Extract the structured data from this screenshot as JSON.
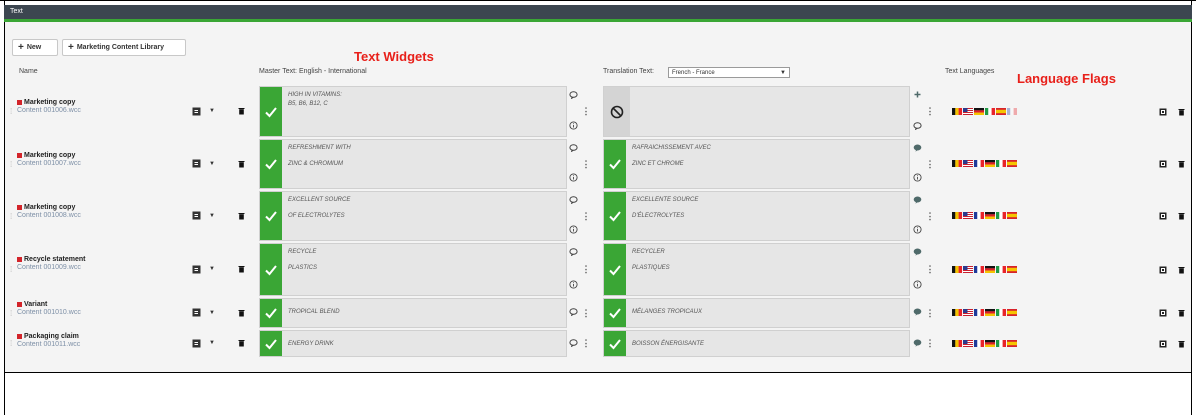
{
  "window": {
    "title": "Text"
  },
  "toolbar": {
    "new_label": "New",
    "library_label": "Marketing Content Library"
  },
  "columns": {
    "name": "Name",
    "master": "Master Text: English - International",
    "translation_label": "Translation Text:",
    "translation_value": "French - France",
    "languages": "Text Languages"
  },
  "annotations": {
    "widgets": "Text Widgets",
    "flags": "Language Flags"
  },
  "colors": {
    "check_green": "#3aa635",
    "status_red": "#d3242a",
    "title_bar": "#3c4650",
    "annotation_red": "#e8201a"
  },
  "icons": [
    "plus-icon",
    "sync-icon",
    "chevron-down-icon",
    "trash-icon",
    "checkmark-icon",
    "comment-icon",
    "info-icon",
    "kebab-icon",
    "blocked-icon",
    "edit-icon",
    "flag-icon"
  ],
  "rows": [
    {
      "name": "Marketing copy",
      "file": "Content 001006.wcc",
      "master_lines": [
        "HIGH IN VITAMINS:",
        "B5, B6, B12, C"
      ],
      "translation_lines": [],
      "translation_status": "blocked",
      "flags": [
        "be",
        "us",
        "de",
        "it",
        "es",
        "fr"
      ],
      "flags_faded": true
    },
    {
      "name": "Marketing copy",
      "file": "Content 001007.wcc",
      "master_lines": [
        "REFRESHMENT WITH",
        "ZINC & CHROMIUM"
      ],
      "translation_lines": [
        "RAFRAICHISSEMENT AVEC",
        "ZINC ET CHROME"
      ],
      "translation_status": "approved",
      "flags": [
        "be",
        "us",
        "fr",
        "de",
        "it",
        "es"
      ],
      "flags_faded": false
    },
    {
      "name": "Marketing copy",
      "file": "Content 001008.wcc",
      "master_lines": [
        "EXCELLENT SOURCE",
        "OF ELECTROLYTES"
      ],
      "translation_lines": [
        "EXCELLENTE SOURCE",
        "D'ÉLECTROLYTES"
      ],
      "translation_status": "approved",
      "flags": [
        "be",
        "us",
        "fr",
        "de",
        "it",
        "es"
      ],
      "flags_faded": false
    },
    {
      "name": "Recycle statement",
      "file": "Content 001009.wcc",
      "master_lines": [
        "RECYCLE",
        "PLASTICS"
      ],
      "translation_lines": [
        "RECYCLER",
        "PLASTIQUES"
      ],
      "translation_status": "approved",
      "flags": [
        "be",
        "us",
        "fr",
        "de",
        "it",
        "es"
      ],
      "flags_faded": false
    },
    {
      "name": "Variant",
      "file": "Content 001010.wcc",
      "master_lines": [
        "TROPICAL BLEND"
      ],
      "translation_lines": [
        "MÉLANGES TROPICAUX"
      ],
      "translation_status": "approved",
      "flags": [
        "be",
        "us",
        "fr",
        "de",
        "it",
        "es"
      ],
      "flags_faded": false
    },
    {
      "name": "Packaging claim",
      "file": "Content 001011.wcc",
      "master_lines": [
        "ENERGY DRINK"
      ],
      "translation_lines": [
        "BOISSON ÉNERGISANTE"
      ],
      "translation_status": "approved",
      "flags": [
        "be",
        "us",
        "fr",
        "de",
        "it",
        "es"
      ],
      "flags_faded": false
    }
  ]
}
